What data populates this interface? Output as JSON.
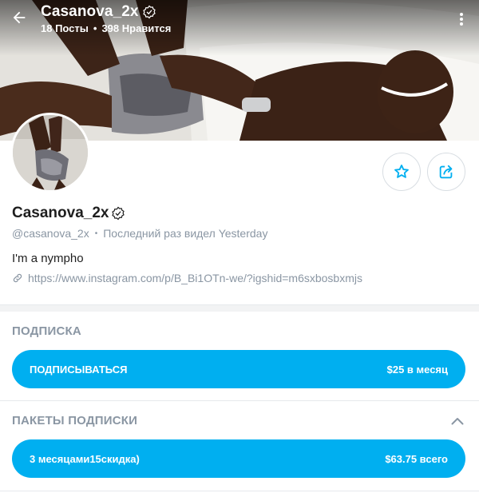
{
  "header": {
    "title": "Casanova_2x",
    "posts": "18 Посты",
    "likes": "398 Нравится",
    "back_icon": "arrow-left-icon",
    "more_icon": "more-vertical-icon"
  },
  "profile": {
    "name": "Casanova_2x",
    "handle": "@casanova_2x",
    "last_seen": "Последний раз видел Yesterday",
    "bio": "I'm a nympho",
    "link": "https://www.instagram.com/p/B_Bi1OTn-we/?igshid=m6sxbosbxmjs",
    "verified_icon": "verified-badge-icon"
  },
  "actions": {
    "favorite_icon": "star-icon",
    "share_icon": "share-icon"
  },
  "subscription": {
    "title": "ПОДПИСКА",
    "button_label": "ПОДПИСЫВАТЬСЯ",
    "button_price": "$25 в месяц"
  },
  "bundles": {
    "title": "ПАКЕТЫ ПОДПИСКИ",
    "items": [
      {
        "label": "3 месяцами15скидка)",
        "price": "$63.75 всего"
      }
    ]
  },
  "colors": {
    "accent": "#00aff0",
    "muted": "#8a96a3",
    "text": "#1e1e1e"
  }
}
